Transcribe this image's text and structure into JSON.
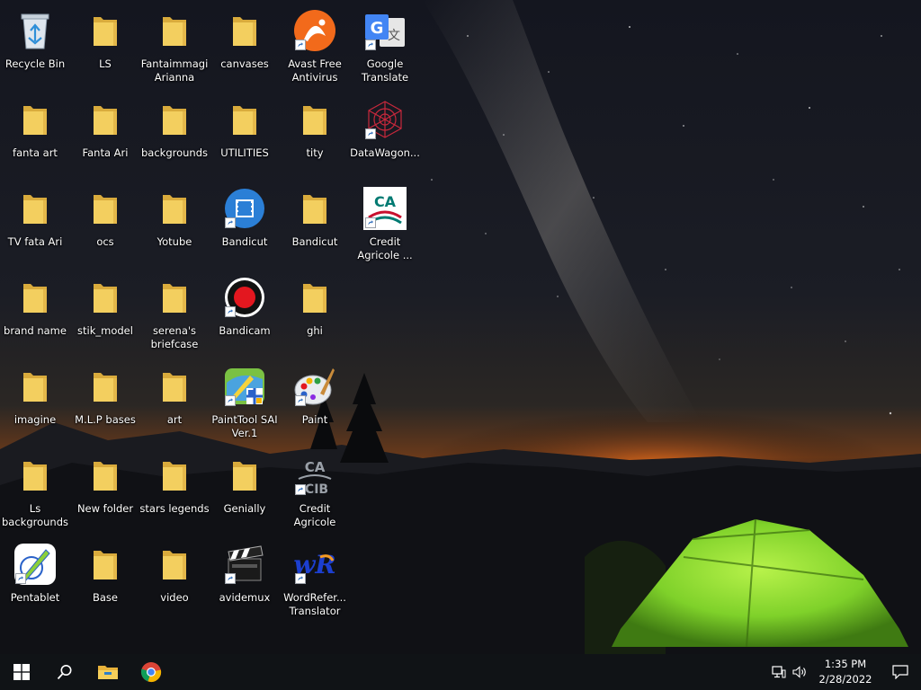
{
  "desktop": {
    "columns": [
      [
        "Recycle Bin",
        "fanta art",
        "TV  fata Ari",
        "brand name",
        "imagine",
        "Ls\nbackgrounds",
        "Pentablet"
      ],
      [
        "LS",
        "Fanta Ari",
        "ocs",
        "stik_model",
        "M.L.P bases",
        "New folder",
        "Base"
      ],
      [
        "Fantaimmagi\nArianna",
        "backgrounds",
        "Yotube",
        "serena's\nbriefcase",
        "art",
        "stars legends",
        "video"
      ],
      [
        "canvases",
        "UTILITIES",
        "Bandicut",
        "Bandicam",
        "PaintTool SAI\nVer.1",
        "Genially",
        "avidemux"
      ],
      [
        "Avast Free\nAntivirus",
        "tity",
        "Bandicut",
        "ghi",
        "Paint",
        "Credit\nAgricole",
        "WordRefer...\nTranslator"
      ],
      [
        "Google\nTranslate",
        "DataWagon...",
        "Credit\nAgricole ..."
      ]
    ],
    "icon_types": [
      [
        "recycle-bin",
        "folder",
        "folder",
        "folder",
        "folder",
        "folder",
        "pentablet"
      ],
      [
        "folder",
        "folder",
        "folder",
        "folder",
        "folder",
        "folder",
        "folder"
      ],
      [
        "folder",
        "folder",
        "folder",
        "folder",
        "folder",
        "folder",
        "folder"
      ],
      [
        "folder",
        "folder",
        "bandicut",
        "bandicam",
        "painttool-sai",
        "folder",
        "avidemux"
      ],
      [
        "avast",
        "folder",
        "folder",
        "folder",
        "paint",
        "credit-agricole-cib",
        "wordreference"
      ],
      [
        "google-translate",
        "datawagon",
        "credit-agricole"
      ]
    ],
    "icon_text": {
      "google_translate_g": "G",
      "google_translate_char": "文",
      "credit_agricole": "CA",
      "cib": "CIB",
      "wordreference": "wR"
    }
  },
  "taskbar": {
    "pinned": [
      "windows-start-icon",
      "search-icon",
      "file-explorer-icon",
      "chrome-icon"
    ],
    "time": "1:35 PM",
    "date": "2/28/2022"
  },
  "colors": {
    "folder": "#f3cf5f",
    "taskbar": "#101316",
    "tent": "#7fd12a"
  }
}
